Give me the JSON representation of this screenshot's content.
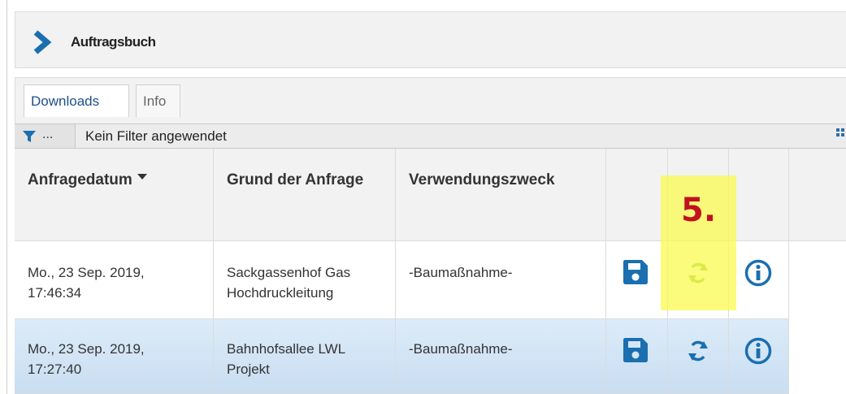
{
  "header": {
    "title": "Auftragsbuch"
  },
  "tabs": [
    {
      "label": "Downloads",
      "active": true
    },
    {
      "label": "Info",
      "active": false
    }
  ],
  "filter": {
    "ellipsis": "...",
    "text": "Kein Filter angewendet"
  },
  "table": {
    "columns": [
      "Anfragedatum",
      "Grund der Anfrage",
      "Verwendungszweck",
      "",
      "",
      ""
    ],
    "sorted_column": "Anfragedatum",
    "rows": [
      {
        "date_line1": "Mo., 23 Sep. 2019,",
        "date_line2": "17:46:34",
        "reason_line1": "Sackgassenhof Gas",
        "reason_line2": "Hochdruckleitung",
        "purpose": "-Baumaßnahme-",
        "selected": false
      },
      {
        "date_line1": "Mo., 23 Sep. 2019,",
        "date_line2": "17:27:40",
        "reason_line1": "Bahnhofsallee LWL",
        "reason_line2": "Projekt",
        "purpose": "-Baumaßnahme-",
        "selected": true
      }
    ],
    "row_actions": [
      "save-icon",
      "refresh-icon",
      "info-icon"
    ]
  },
  "annotation": {
    "step_label": "5."
  },
  "colors": {
    "accent": "#1a6fb0",
    "refresh_highlighted": "#7fbf3a",
    "highlight": "#f6f65a",
    "step": "#c1121f"
  }
}
